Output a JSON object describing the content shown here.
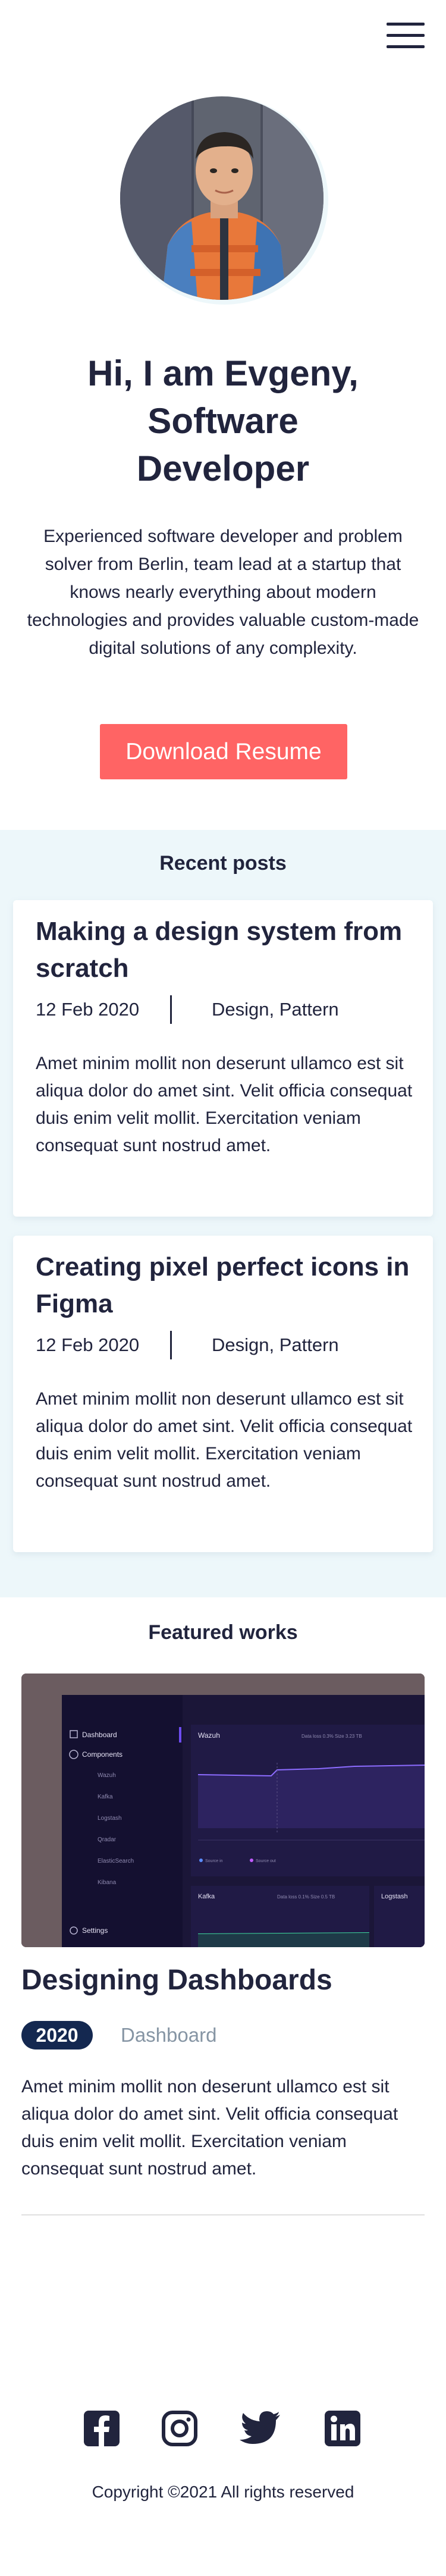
{
  "header": {
    "menu_icon": "hamburger-menu-icon"
  },
  "hero": {
    "title_lines": [
      "Hi, I am Evgeny,",
      "Software",
      "Developer"
    ],
    "description": "Experienced software developer and problem solver from Berlin, team lead at a startup that knows nearly everything about modern technologies and provides valuable custom-made digital solutions of any complexity.",
    "resume_button": "Download Resume"
  },
  "recent_posts": {
    "title": "Recent posts",
    "posts": [
      {
        "title": "Making a design system from scratch",
        "date": "12 Feb 2020",
        "tags": "Design, Pattern",
        "body": "Amet minim mollit non deserunt ullamco est sit aliqua dolor do amet sint. Velit officia consequat duis enim velit mollit. Exercitation veniam consequat sunt nostrud amet."
      },
      {
        "title": "Creating pixel perfect icons in Figma",
        "date": "12 Feb 2020",
        "tags": "Design, Pattern",
        "body": "Amet minim mollit non deserunt ullamco est sit aliqua dolor do amet sint. Velit officia consequat duis enim velit mollit. Exercitation veniam consequat sunt nostrud amet."
      }
    ]
  },
  "featured_works": {
    "title": "Featured works",
    "works": [
      {
        "title": "Designing Dashboards",
        "year": "2020",
        "category": "Dashboard",
        "description": "Amet minim mollit non deserunt ullamco est sit aliqua dolor do amet sint. Velit officia consequat duis enim velit mollit. Exercitation veniam consequat sunt nostrud amet.",
        "thumbnail": {
          "nav": [
            "Dashboard",
            "Components",
            "Wazuh",
            "Kafka",
            "Logstash",
            "Qradar",
            "ElasticSearch",
            "Kibana",
            "Settings"
          ],
          "panel_main": "Wazuh",
          "panel_main_stats": "Data loss  0.3%   Size  3.23 TB",
          "panel_kafka": "Kafka",
          "panel_kafka_stats": "Data loss  0.1%   Size  0.5 TB",
          "panel_logstash": "Logstash",
          "legend": [
            "Source in",
            "Source out"
          ]
        }
      }
    ]
  },
  "footer": {
    "socials": [
      "facebook-icon",
      "instagram-icon",
      "twitter-icon",
      "linkedin-icon"
    ],
    "copyright": "Copyright ©2021 All rights reserved"
  },
  "colors": {
    "primary_text": "#21243D",
    "accent": "#FF6464",
    "section_bg": "#EDF7FA",
    "badge_bg": "#142850",
    "muted": "#8695A4"
  }
}
